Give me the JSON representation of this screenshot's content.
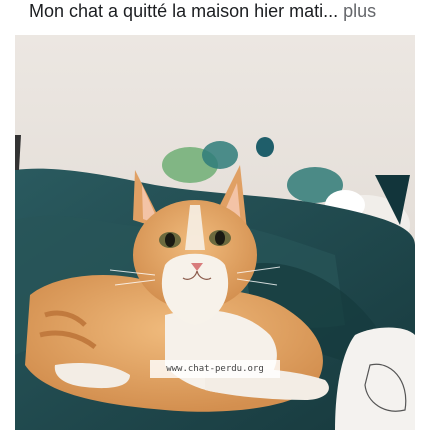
{
  "post": {
    "caption": "Mon chat a quitté la maison hier mati...",
    "more_label": "plus"
  },
  "photo": {
    "watermark": "www.chat-perdu.org",
    "subject": "orange-and-white cat lying on dark teal blanket"
  },
  "colors": {
    "caption_text": "#1c1e21",
    "more_link": "#65676b",
    "wall": "#e8e3de",
    "blanket": "#1f4a4e",
    "cat_orange": "#e2a567",
    "cat_white": "#f6f1ea"
  }
}
